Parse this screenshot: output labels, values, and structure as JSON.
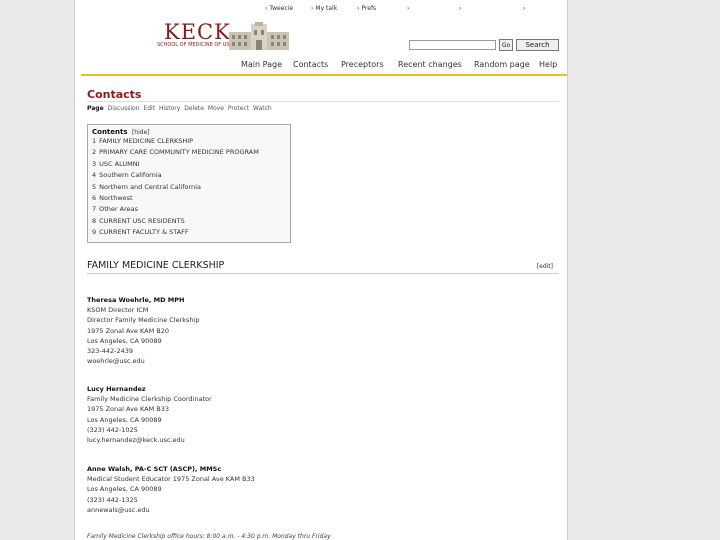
{
  "user_links": [
    "Tweecie",
    "My talk",
    "Prefs",
    "",
    "",
    ""
  ],
  "logo": {
    "name": "KECK",
    "subtitle": "SCHOOL OF MEDICINE OF USC"
  },
  "search": {
    "placeholder": "",
    "go_label": "Go",
    "search_label": "Search"
  },
  "nav": [
    "Main Page",
    "Contacts",
    "Preceptors",
    "Recent changes",
    "Random page",
    "Help"
  ],
  "page": {
    "title": "Contacts",
    "actions": [
      "Page",
      "Discussion",
      "Edit",
      "History",
      "Delete",
      "Move",
      "Protect",
      "Watch"
    ]
  },
  "toc": {
    "heading": "Contents",
    "hide_label": "[hide]",
    "items": [
      {
        "num": "1",
        "label": "FAMILY MEDICINE CLERKSHIP"
      },
      {
        "num": "2",
        "label": "PRIMARY CARE COMMUNITY MEDICINE PROGRAM"
      },
      {
        "num": "3",
        "label": "USC ALUMNI"
      },
      {
        "num": "4",
        "label": "Southern California"
      },
      {
        "num": "5",
        "label": "Northern and Central California"
      },
      {
        "num": "6",
        "label": "Northwest"
      },
      {
        "num": "7",
        "label": "Other Areas"
      },
      {
        "num": "8",
        "label": "CURRENT USC RESIDENTS"
      },
      {
        "num": "9",
        "label": "CURRENT FACULTY & STAFF"
      }
    ]
  },
  "section": {
    "title": "FAMILY MEDICINE CLERKSHIP",
    "edit_label": "[edit]"
  },
  "contacts": [
    {
      "name": "Theresa Woehrle, MD MPH",
      "lines": [
        "KSOM Director ICM",
        "Director Family Medicine Clerkship",
        "1975 Zonal Ave KAM B20",
        "Los Angeles, CA 90089",
        "323-442-2439",
        "woehrle@usc.edu"
      ]
    },
    {
      "name": "Lucy Hernandez",
      "lines": [
        "Family Medicine Clerkship Coordinator",
        "1975 Zonal Ave KAM B33",
        "Los Angeles, CA 90089",
        "(323) 442-1025",
        "lucy.hernandez@keck.usc.edu"
      ]
    },
    {
      "name": "Anne Walsh, PA-C SCT (ASCP), MMSc",
      "lines": [
        "Medical Student Educator 1975 Zonal Ave KAM B33",
        "Los Angeles, CA 90089",
        "(323) 442-1325",
        "annewals@usc.edu"
      ]
    }
  ],
  "footnote": "Family Medicine Clerkship office hours: 8:00 a.m. - 4:30 p.m. Monday thru Friday"
}
